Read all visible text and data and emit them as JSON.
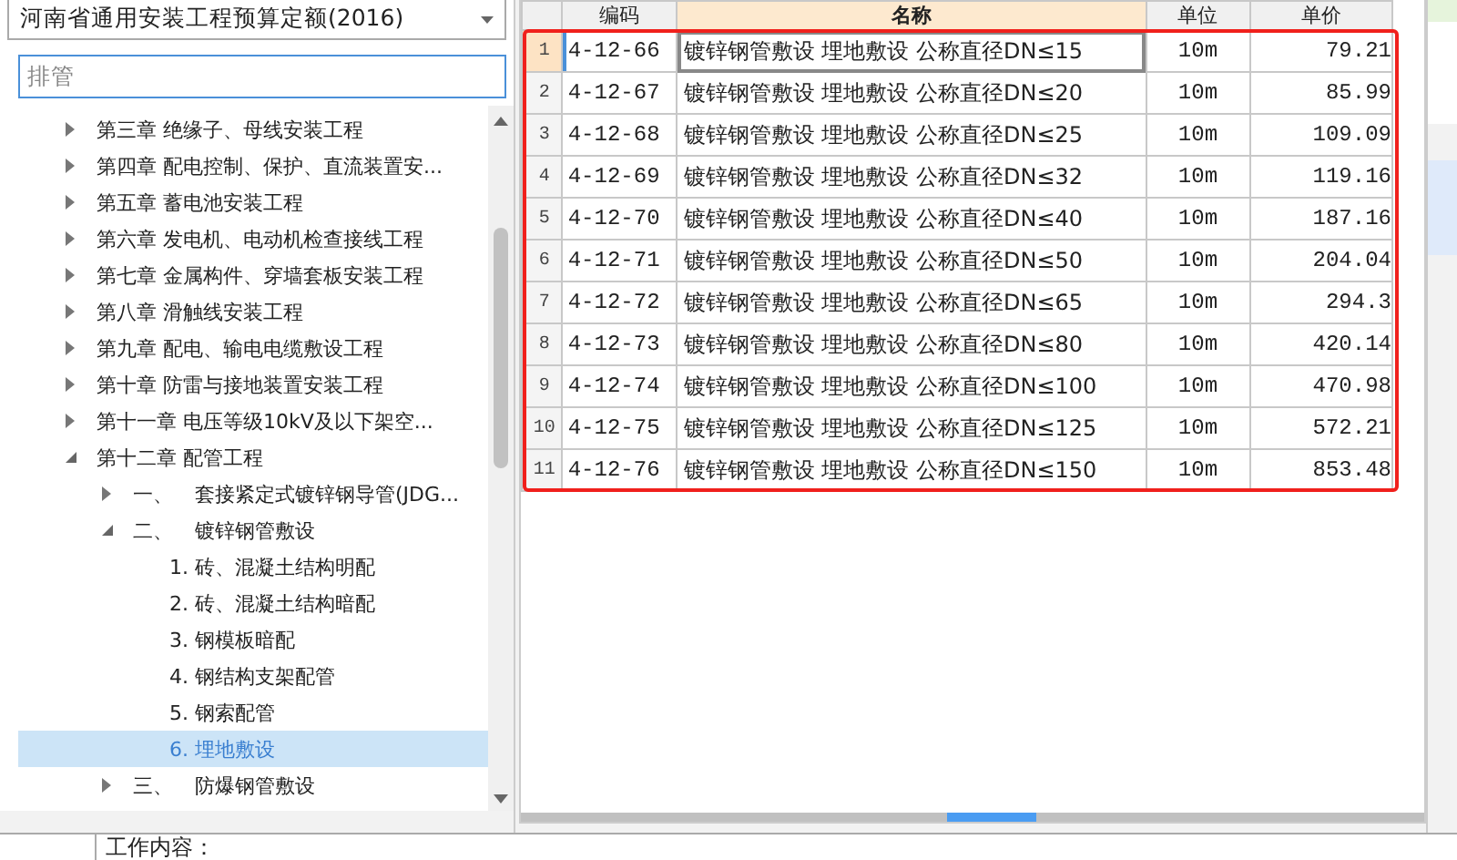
{
  "quota_select": {
    "value": "河南省通用安装工程预算定额(2016)"
  },
  "search": {
    "value": "排管"
  },
  "tree": [
    {
      "label": "第三章 绝缘子、母线安装工程",
      "expanded": false,
      "selected": false
    },
    {
      "label": "第四章 配电控制、保护、直流装置安...",
      "expanded": false,
      "selected": false
    },
    {
      "label": "第五章 蓄电池安装工程",
      "expanded": false,
      "selected": false
    },
    {
      "label": "第六章 发电机、电动机检查接线工程",
      "expanded": false,
      "selected": false
    },
    {
      "label": "第七章 金属构件、穿墙套板安装工程",
      "expanded": false,
      "selected": false
    },
    {
      "label": "第八章 滑触线安装工程",
      "expanded": false,
      "selected": false
    },
    {
      "label": "第九章 配电、输电电缆敷设工程",
      "expanded": false,
      "selected": false
    },
    {
      "label": "第十章 防雷与接地装置安装工程",
      "expanded": false,
      "selected": false
    },
    {
      "label": "第十一章 电压等级10kV及以下架空...",
      "expanded": false,
      "selected": false
    },
    {
      "label": "第十二章 配管工程",
      "expanded": true,
      "selected": false,
      "children": [
        {
          "label": "一、",
          "text": "套接紧定式镀锌钢导管(JDG...",
          "expanded": false,
          "selected": false
        },
        {
          "label": "二、",
          "text": "镀锌钢管敷设",
          "expanded": true,
          "selected": false,
          "children": [
            {
              "label": "1. 砖、混凝土结构明配",
              "selected": false
            },
            {
              "label": "2. 砖、混凝土结构暗配",
              "selected": false
            },
            {
              "label": "3. 钢模板暗配",
              "selected": false
            },
            {
              "label": "4. 钢结构支架配管",
              "selected": false
            },
            {
              "label": "5. 钢索配管",
              "selected": false
            },
            {
              "label": "6. 埋地敷设",
              "selected": true
            }
          ]
        },
        {
          "label": "三、",
          "text": "防爆钢管敷设",
          "expanded": false,
          "selected": false
        }
      ]
    }
  ],
  "table": {
    "columns": [
      "编码",
      "名称",
      "单位",
      "单价"
    ],
    "rows": [
      {
        "no": "1",
        "code": "4-12-66",
        "name": "镀锌钢管敷设 埋地敷设 公称直径DN≤15",
        "unit": "10m",
        "price": "79.21",
        "selected": true
      },
      {
        "no": "2",
        "code": "4-12-67",
        "name": "镀锌钢管敷设 埋地敷设 公称直径DN≤20",
        "unit": "10m",
        "price": "85.99",
        "selected": false
      },
      {
        "no": "3",
        "code": "4-12-68",
        "name": "镀锌钢管敷设 埋地敷设 公称直径DN≤25",
        "unit": "10m",
        "price": "109.09",
        "selected": false
      },
      {
        "no": "4",
        "code": "4-12-69",
        "name": "镀锌钢管敷设 埋地敷设 公称直径DN≤32",
        "unit": "10m",
        "price": "119.16",
        "selected": false
      },
      {
        "no": "5",
        "code": "4-12-70",
        "name": "镀锌钢管敷设 埋地敷设 公称直径DN≤40",
        "unit": "10m",
        "price": "187.16",
        "selected": false
      },
      {
        "no": "6",
        "code": "4-12-71",
        "name": "镀锌钢管敷设 埋地敷设 公称直径DN≤50",
        "unit": "10m",
        "price": "204.04",
        "selected": false
      },
      {
        "no": "7",
        "code": "4-12-72",
        "name": "镀锌钢管敷设 埋地敷设 公称直径DN≤65",
        "unit": "10m",
        "price": "294.3",
        "selected": false
      },
      {
        "no": "8",
        "code": "4-12-73",
        "name": "镀锌钢管敷设 埋地敷设 公称直径DN≤80",
        "unit": "10m",
        "price": "420.14",
        "selected": false
      },
      {
        "no": "9",
        "code": "4-12-74",
        "name": "镀锌钢管敷设 埋地敷设 公称直径DN≤100",
        "unit": "10m",
        "price": "470.98",
        "selected": false
      },
      {
        "no": "10",
        "code": "4-12-75",
        "name": "镀锌钢管敷设 埋地敷设 公称直径DN≤125",
        "unit": "10m",
        "price": "572.21",
        "selected": false
      },
      {
        "no": "11",
        "code": "4-12-76",
        "name": "镀锌钢管敷设 埋地敷设 公称直径DN≤150",
        "unit": "10m",
        "price": "853.48",
        "selected": false
      }
    ]
  },
  "work_content": {
    "label": "工作内容："
  }
}
